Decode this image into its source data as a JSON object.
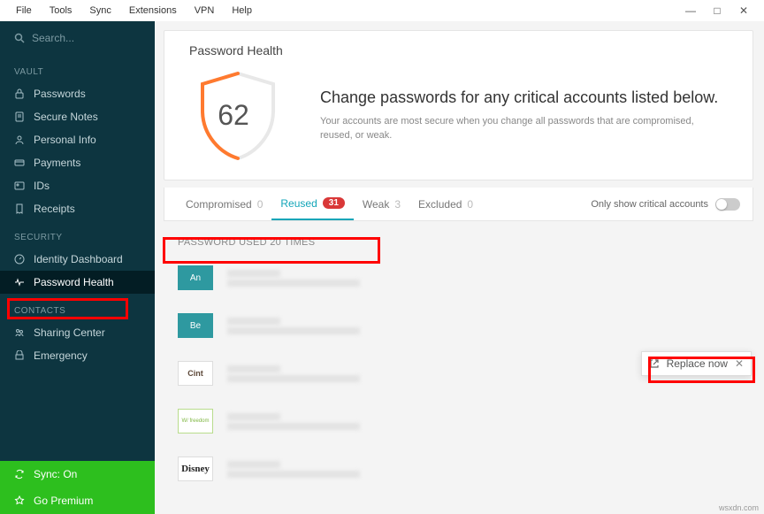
{
  "menubar": {
    "items": [
      "File",
      "Tools",
      "Sync",
      "Extensions",
      "VPN",
      "Help"
    ]
  },
  "search": {
    "placeholder": "Search..."
  },
  "sidebar": {
    "sections": [
      {
        "header": "VAULT",
        "items": [
          {
            "icon": "lock",
            "label": "Passwords"
          },
          {
            "icon": "note",
            "label": "Secure Notes"
          },
          {
            "icon": "person",
            "label": "Personal Info"
          },
          {
            "icon": "card",
            "label": "Payments"
          },
          {
            "icon": "id",
            "label": "IDs"
          },
          {
            "icon": "receipt",
            "label": "Receipts"
          }
        ]
      },
      {
        "header": "SECURITY",
        "items": [
          {
            "icon": "dashboard",
            "label": "Identity Dashboard"
          },
          {
            "icon": "pulse",
            "label": "Password Health",
            "active": true
          }
        ]
      },
      {
        "header": "CONTACTS",
        "items": [
          {
            "icon": "share",
            "label": "Sharing Center"
          },
          {
            "icon": "emergency",
            "label": "Emergency"
          }
        ]
      }
    ],
    "footer": {
      "sync": "Sync: On",
      "premium": "Go Premium"
    }
  },
  "health": {
    "title": "Password Health",
    "score": "62",
    "headline": "Change passwords for any critical accounts listed below.",
    "sub": "Your accounts are most secure when you change all passwords that are compromised, reused, or weak."
  },
  "tabs": {
    "compromised": {
      "label": "Compromised",
      "count": "0"
    },
    "reused": {
      "label": "Reused",
      "count": "31"
    },
    "weak": {
      "label": "Weak",
      "count": "3"
    },
    "excluded": {
      "label": "Excluded",
      "count": "0"
    },
    "toggle_label": "Only show critical accounts"
  },
  "group": {
    "header": "PASSWORD USED 20 TIMES"
  },
  "rows": {
    "r1": "An",
    "r2": "Be",
    "r3": "Cint",
    "r4": "W/ freedom",
    "r5": "Disney"
  },
  "replace": {
    "label": "Replace now"
  },
  "watermark": "wsxdn.com"
}
